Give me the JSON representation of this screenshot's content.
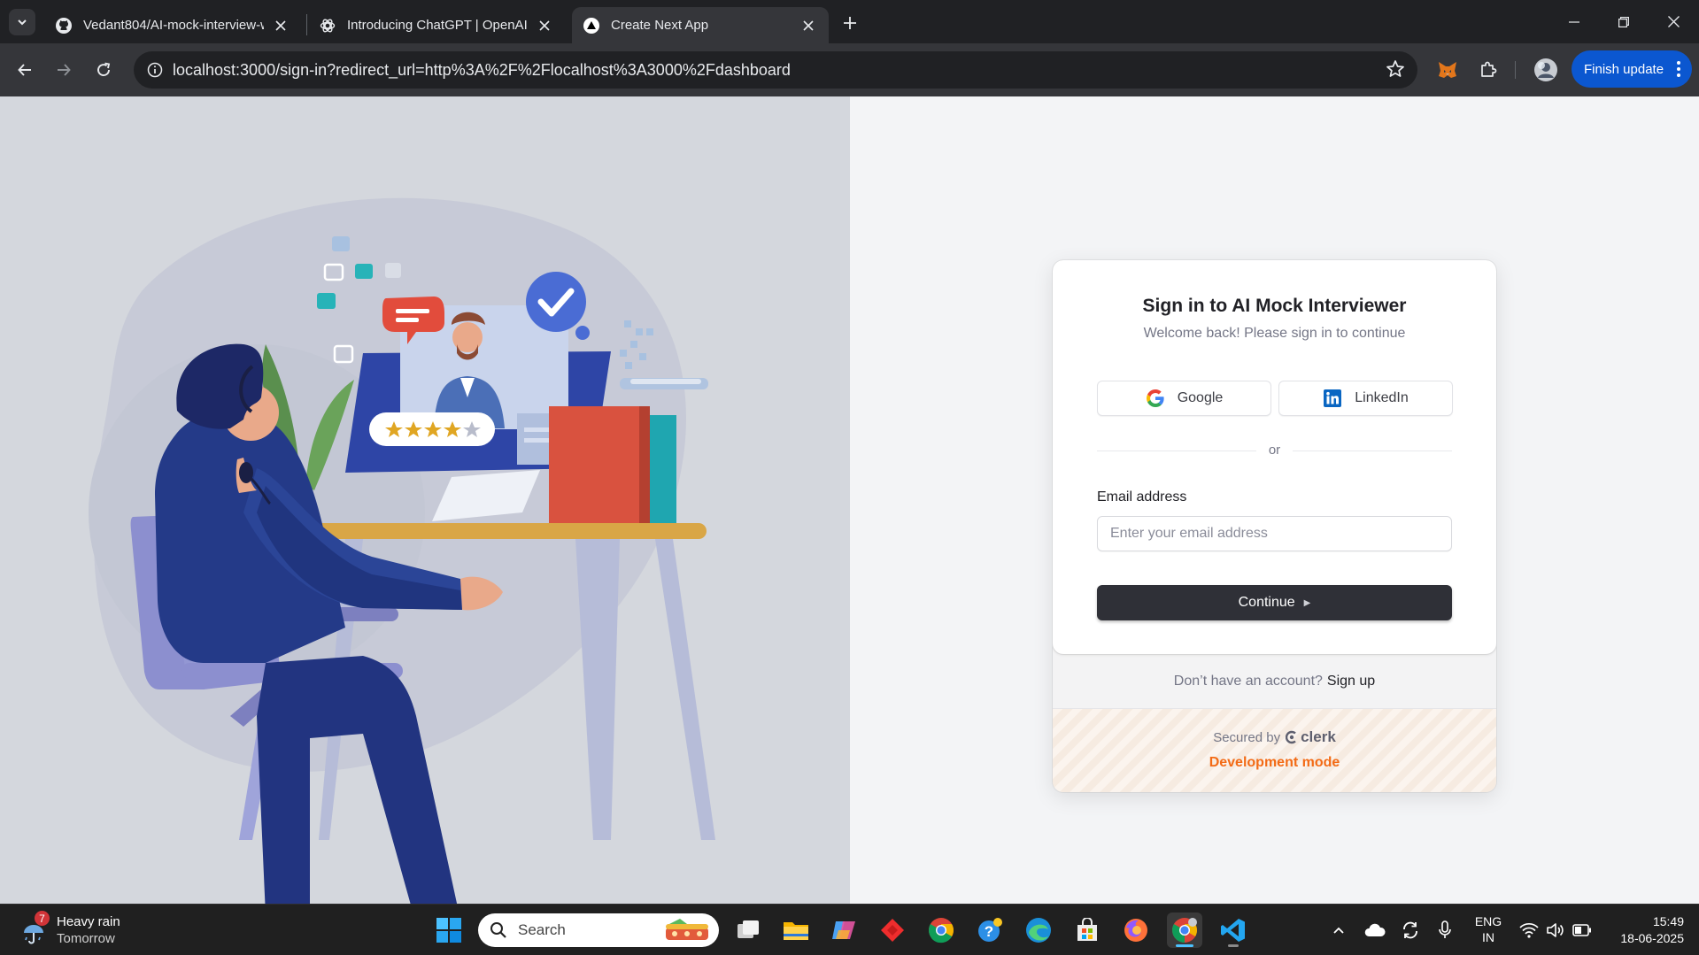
{
  "browser": {
    "tabs": [
      {
        "title": "Vedant804/AI-mock-interview-w",
        "icon": "github-icon",
        "active": false
      },
      {
        "title": "Introducing ChatGPT | OpenAI",
        "icon": "openai-icon",
        "active": false
      },
      {
        "title": "Create Next App",
        "icon": "nextjs-icon",
        "active": true
      }
    ],
    "url": "localhost:3000/sign-in?redirect_url=http%3A%2F%2Flocalhost%3A3000%2Fdashboard",
    "finish_update_label": "Finish update"
  },
  "signin": {
    "title": "Sign in to AI Mock Interviewer",
    "subtitle": "Welcome back! Please sign in to continue",
    "google_label": "Google",
    "linkedin_label": "LinkedIn",
    "divider": "or",
    "email_label": "Email address",
    "email_placeholder": "Enter your email address",
    "email_value": "",
    "continue_label": "Continue",
    "footer_text": "Don’t have an account?",
    "signup_link": "Sign up",
    "secured_by": "Secured by",
    "clerk_word": "clerk",
    "dev_mode": "Development mode"
  },
  "taskbar": {
    "weather_title": "Heavy rain",
    "weather_sub": "Tomorrow",
    "weather_badge": "7",
    "search_label": "Search",
    "lang_top": "ENG",
    "lang_bottom": "IN",
    "time": "15:49",
    "date": "18-06-2025"
  },
  "colors": {
    "accent_dark": "#2f3037",
    "dev_mode": "#f36b16",
    "update_button": "#0b57d0",
    "linkedin": "#0a66c2"
  }
}
